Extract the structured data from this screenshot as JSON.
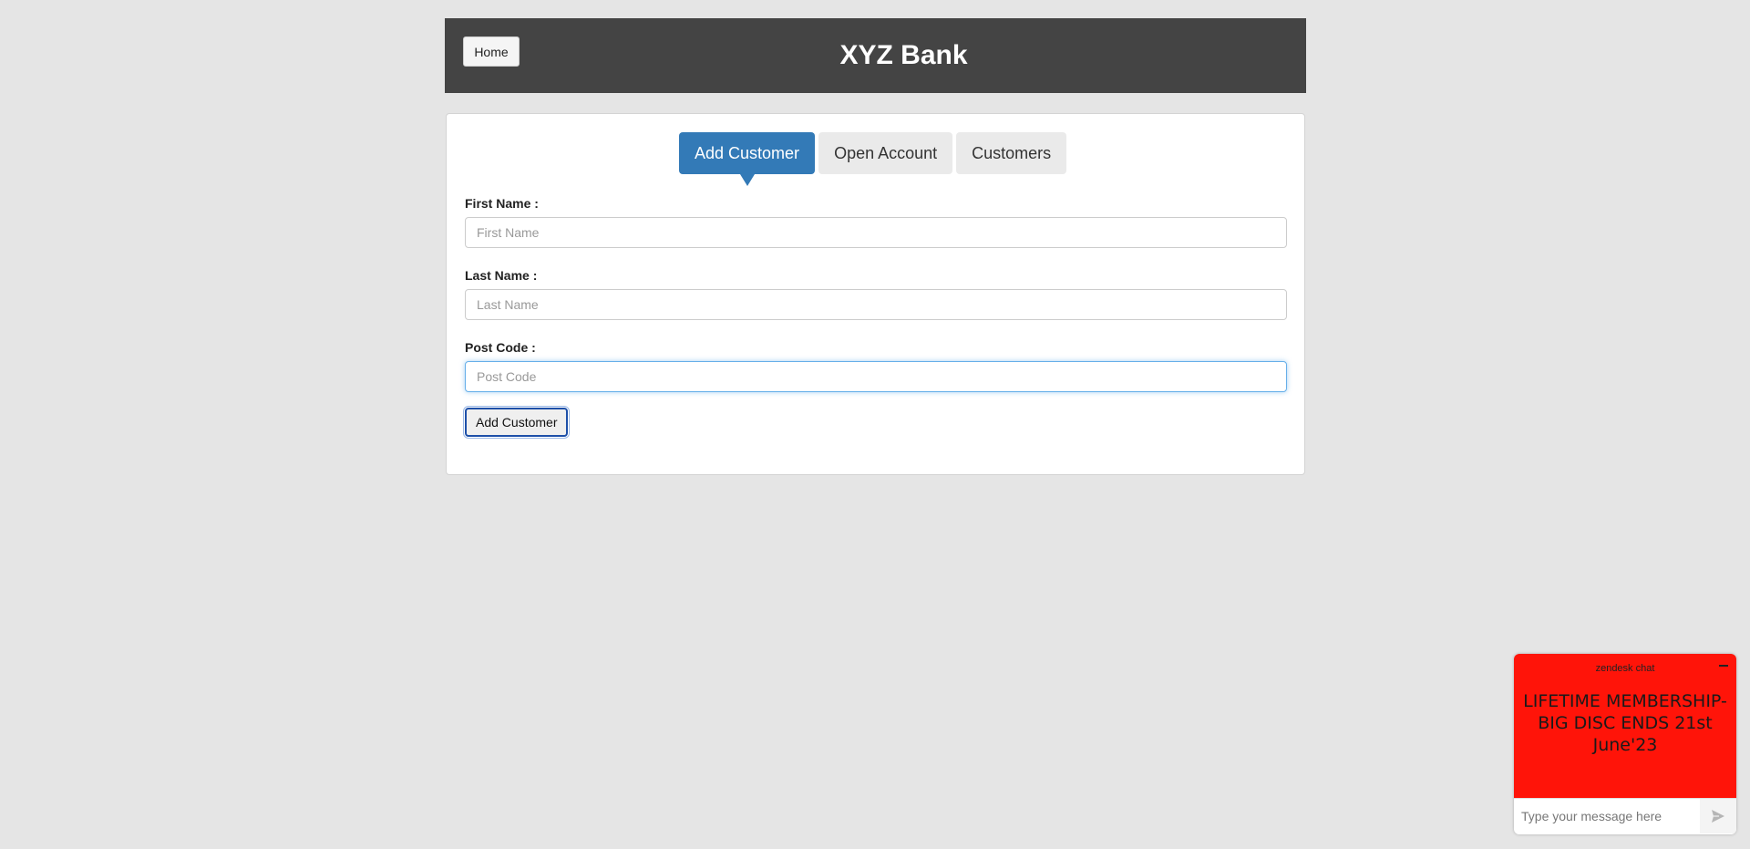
{
  "header": {
    "home_label": "Home",
    "title": "XYZ Bank",
    "background": "#444444"
  },
  "tabs": [
    {
      "label": "Add Customer",
      "active": true
    },
    {
      "label": "Open Account",
      "active": false
    },
    {
      "label": "Customers",
      "active": false
    }
  ],
  "form": {
    "first_name": {
      "label": "First Name :",
      "placeholder": "First Name",
      "value": ""
    },
    "last_name": {
      "label": "Last Name :",
      "placeholder": "Last Name",
      "value": ""
    },
    "post_code": {
      "label": "Post Code :",
      "placeholder": "Post Code",
      "value": "",
      "focused": true
    },
    "submit_label": "Add Customer"
  },
  "chat": {
    "brand": "zendesk chat",
    "minimize_icon": "minus",
    "message": "LIFETIME MEMBERSHIP- BIG DISC ENDS 21st June'23",
    "input_placeholder": "Type your message here",
    "send_icon": "paper-plane",
    "background": "#ff1409"
  },
  "colors": {
    "page_background": "#e5e5e5",
    "accent": "#337ab7",
    "tab_inactive": "#eaeaea"
  }
}
